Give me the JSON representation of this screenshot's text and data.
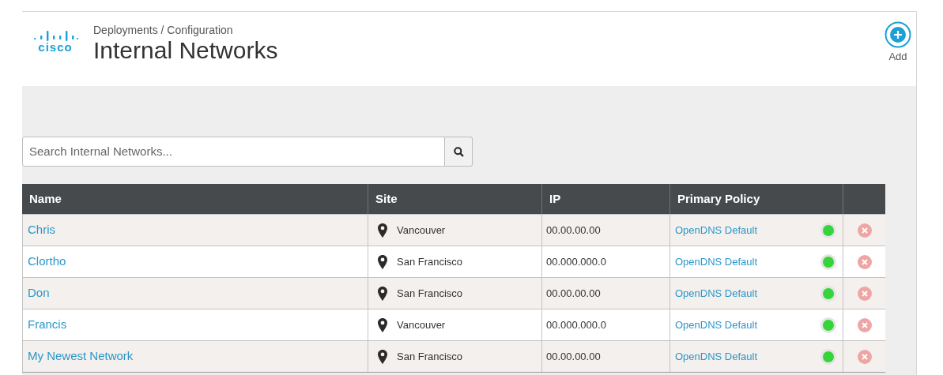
{
  "header": {
    "logo_text": "cisco",
    "breadcrumb": "Deployments / Configuration",
    "title": "Internal Networks",
    "add_label": "Add"
  },
  "search": {
    "placeholder": "Search Internal Networks..."
  },
  "table": {
    "columns": [
      "Name",
      "Site",
      "IP",
      "Primary Policy"
    ],
    "rows": [
      {
        "name": "Chris",
        "site": "Vancouver",
        "ip": "00.00.00.00",
        "policy": "OpenDNS Default",
        "active": true
      },
      {
        "name": "Clortho",
        "site": "San Francisco",
        "ip": "00.000.000.0",
        "policy": "OpenDNS Default",
        "active": true
      },
      {
        "name": "Don",
        "site": "San Francisco",
        "ip": "00.00.00.00",
        "policy": "OpenDNS Default",
        "active": true
      },
      {
        "name": "Francis",
        "site": "Vancouver",
        "ip": "00.000.000.0",
        "policy": "OpenDNS Default",
        "active": true
      },
      {
        "name": "My Newest Network",
        "site": "San Francisco",
        "ip": "00.00.00.00",
        "policy": "OpenDNS Default",
        "active": true
      }
    ]
  }
}
